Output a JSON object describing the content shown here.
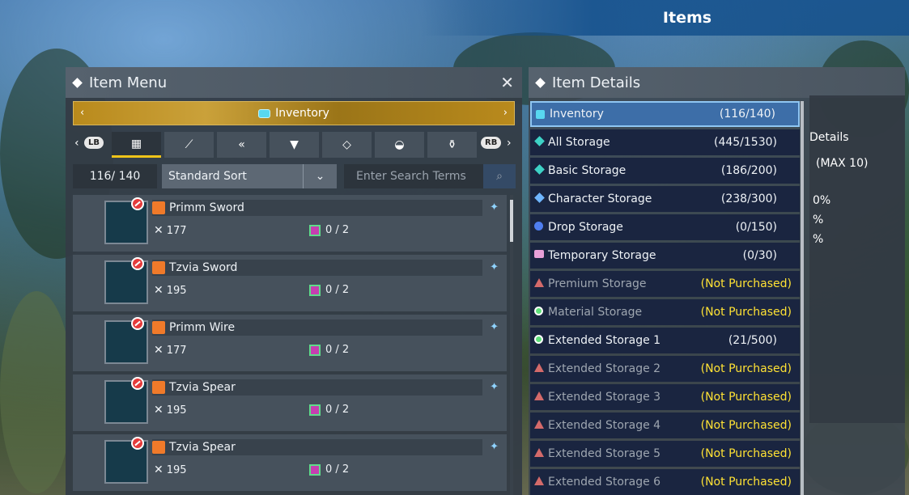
{
  "screen_title": "Items",
  "item_menu": {
    "title": "Item Menu",
    "inventory_label": "Inventory",
    "lb": "LB",
    "rb": "RB",
    "category_icons": [
      "grid-icon",
      "sword-icon",
      "claw-icon",
      "shirt-icon",
      "tag-icon",
      "ball-icon",
      "pot-icon"
    ],
    "count": "116/ 140",
    "sort": "Standard Sort",
    "search_placeholder": "Enter Search Terms",
    "items": [
      {
        "name": "Primm Sword",
        "power": "177",
        "slots": "0 / 2"
      },
      {
        "name": "Tzvia Sword",
        "power": "195",
        "slots": "0 / 2"
      },
      {
        "name": "Primm Wire",
        "power": "177",
        "slots": "0 / 2"
      },
      {
        "name": "Tzvia Spear",
        "power": "195",
        "slots": "0 / 2"
      },
      {
        "name": "Tzvia Spear",
        "power": "195",
        "slots": "0 / 2"
      }
    ]
  },
  "item_details": {
    "title": "Item Details",
    "partial_tab": "Details",
    "partial_max": "(MAX 10)",
    "partial_pct": [
      "0%",
      "%",
      "%"
    ],
    "storages": [
      {
        "label": "Inventory",
        "value": "(116/140)",
        "icon": "cyan"
      },
      {
        "label": "All Storage",
        "value": "(445/1530)",
        "icon": "teal"
      },
      {
        "label": "Basic Storage",
        "value": "(186/200)",
        "icon": "teal"
      },
      {
        "label": "Character Storage",
        "value": "(238/300)",
        "icon": "blue"
      },
      {
        "label": "Drop Storage",
        "value": "(0/150)",
        "icon": "drop"
      },
      {
        "label": "Temporary Storage",
        "value": "(0/30)",
        "icon": "pink"
      },
      {
        "label": "Premium Storage",
        "value": "(Not Purchased)",
        "icon": "warn"
      },
      {
        "label": "Material Storage",
        "value": "(Not Purchased)",
        "icon": "gem"
      },
      {
        "label": "Extended Storage 1",
        "value": "(21/500)",
        "icon": "gem"
      },
      {
        "label": "Extended Storage 2",
        "value": "(Not Purchased)",
        "icon": "warn"
      },
      {
        "label": "Extended Storage 3",
        "value": "(Not Purchased)",
        "icon": "warn"
      },
      {
        "label": "Extended Storage 4",
        "value": "(Not Purchased)",
        "icon": "warn"
      },
      {
        "label": "Extended Storage 5",
        "value": "(Not Purchased)",
        "icon": "warn"
      },
      {
        "label": "Extended Storage 6",
        "value": "(Not Purchased)",
        "icon": "warn"
      }
    ]
  }
}
